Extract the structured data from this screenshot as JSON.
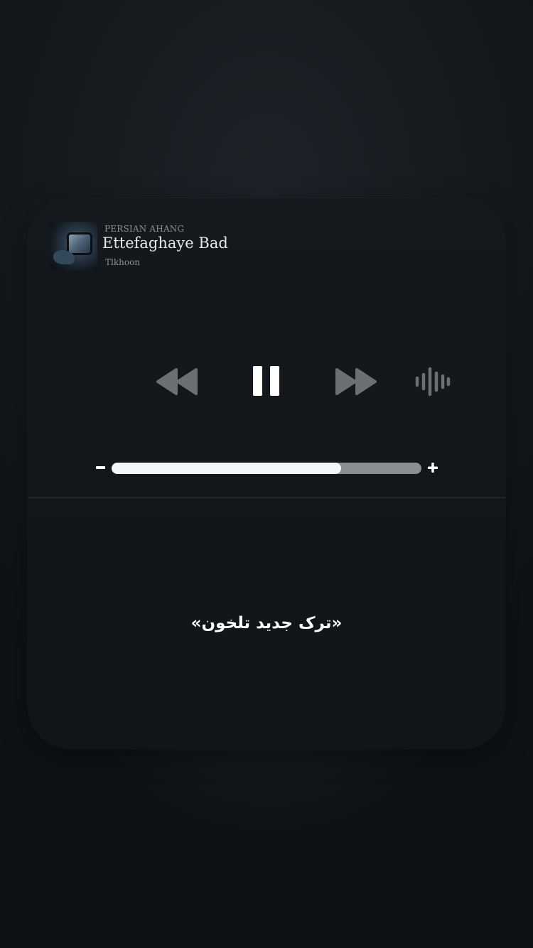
{
  "now_playing": {
    "source_label": "PERSIAN AHANG",
    "title": "Ettefaghaye Bad",
    "artist": "Tlkhoon",
    "artwork": "album-artwork"
  },
  "controls": {
    "rewind_icon": "rewind-icon",
    "pause_icon": "pause-icon",
    "forward_icon": "fast-forward-icon",
    "audio_output_icon": "audio-waveform-icon"
  },
  "volume": {
    "minus_label": "-",
    "plus_label": "+",
    "level": 0.74
  },
  "caption": "«ترک جدید تلخون»",
  "colors": {
    "accent_track_fill": "#f5f6f7",
    "accent_track_empty": "#8a8f93",
    "icon_dim": "#6b7075",
    "icon_bright": "#ffffff"
  }
}
